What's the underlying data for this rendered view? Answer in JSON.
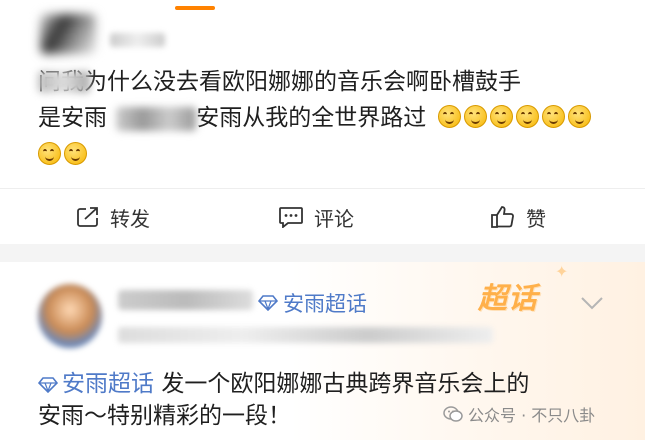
{
  "post1": {
    "text_line1": "问我为什么没去看欧阳娜娜的音乐会啊卧槽鼓手",
    "text_line2_part1": "是安雨",
    "text_line2_part2": " 安雨从我的全世界路过",
    "emoji_name": "laugh-tears-emoji",
    "actions": {
      "repost": "转发",
      "comment": "评论",
      "like": "赞"
    }
  },
  "post2": {
    "topic_tag": "安雨超话",
    "supertopic_badge": "超话",
    "body_tag": "安雨超话",
    "body_line1": " 发一个欧阳娜娜古典跨界音乐会上的",
    "body_line2": "安雨～特别精彩的一段！"
  },
  "watermark": "公众号 · 不只八卦",
  "colors": {
    "accent": "#ff8200",
    "link": "#4f7ac8",
    "badge": "#ffb04a"
  }
}
